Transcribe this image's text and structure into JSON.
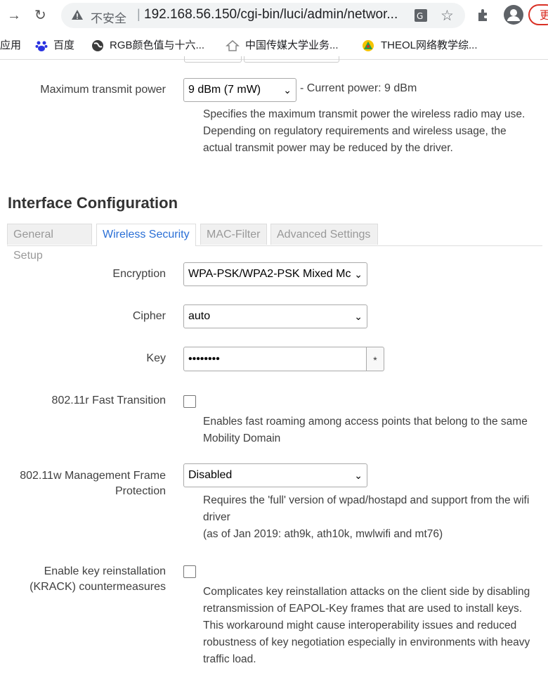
{
  "browser": {
    "insecure_label": "不安全",
    "separator": "|",
    "url": "192.168.56.150/cgi-bin/luci/admin/networ...",
    "update_label": "更"
  },
  "bookmarks": [
    {
      "label": "应用",
      "icon": "apps-icon"
    },
    {
      "label": "百度",
      "icon": "baidu-icon"
    },
    {
      "label": "RGB颜色值与十六...",
      "icon": "globe-icon"
    },
    {
      "label": "中国传媒大学业务...",
      "icon": "home-icon"
    },
    {
      "label": "THEOL网络教学综...",
      "icon": "theol-icon"
    }
  ],
  "power": {
    "label": "Maximum transmit power",
    "value": "9 dBm (7 mW)",
    "current": "- Current power: 9 dBm",
    "help": "Specifies the maximum transmit power the wireless radio may use. Depending on regulatory requirements and wireless usage, the actual transmit power may be reduced by the driver."
  },
  "section_title": "Interface Configuration",
  "tabs": [
    "General Setup",
    "Wireless Security",
    "MAC-Filter",
    "Advanced Settings"
  ],
  "encryption": {
    "label": "Encryption",
    "value": "WPA-PSK/WPA2-PSK Mixed Mc"
  },
  "cipher": {
    "label": "Cipher",
    "value": "auto"
  },
  "key": {
    "label": "Key",
    "value": "••••••••",
    "toggle": "*"
  },
  "fast_transition": {
    "label": "802.11r Fast Transition",
    "help": "Enables fast roaming among access points that belong to the same Mobility Domain"
  },
  "mfp": {
    "label_line1": "802.11w Management Frame",
    "label_line2": "Protection",
    "value": "Disabled",
    "help_line1": "Requires the 'full' version of wpad/hostapd and support from the wifi driver",
    "help_line2": "(as of Jan 2019: ath9k, ath10k, mwlwifi and mt76)"
  },
  "krack": {
    "label_line1": "Enable key reinstallation",
    "label_line2": "(KRACK) countermeasures",
    "help": "Complicates key reinstallation attacks on the client side by disabling retransmission of EAPOL-Key frames that are used to install keys. This workaround might cause interoperability issues and reduced robustness of key negotiation especially in environments with heavy traffic load."
  }
}
